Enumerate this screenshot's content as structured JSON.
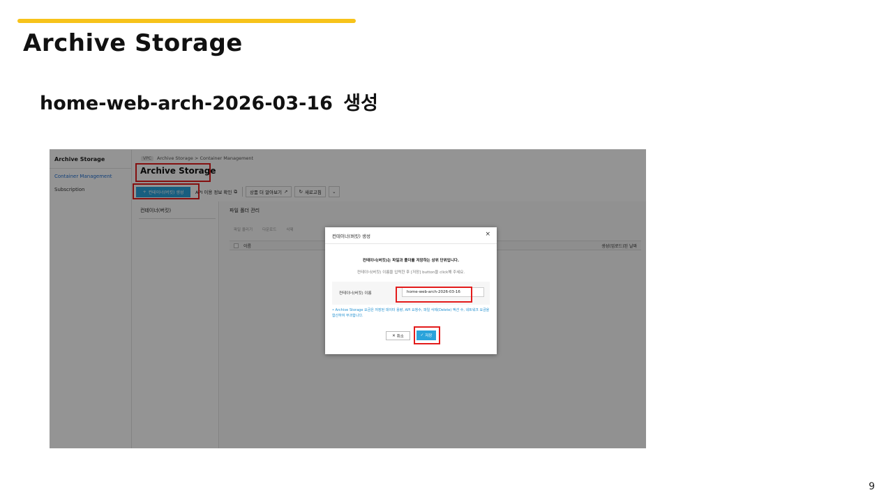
{
  "slide": {
    "title": "Archive Storage",
    "subtitle": "home-web-arch-2026-03-16  생성",
    "page_number": "9",
    "accent_color": "#f7c31a",
    "highlight_color": "#e31b1b"
  },
  "screenshot": {
    "sidebar": {
      "title": "Archive Storage",
      "items": [
        {
          "label": "Container Management",
          "active": true
        },
        {
          "label": "Subscription",
          "active": false
        }
      ]
    },
    "breadcrumb": {
      "vpc": "VPC",
      "items": [
        "Archive Storage",
        "Container Management"
      ],
      "separator": ">"
    },
    "main_title": "Archive Storage",
    "toolbar": {
      "create_label": "컨테이너(버킷) 생성",
      "api_label": "API 이용 정보 확인",
      "more_label": "상품 더 알아보기",
      "refresh_label": "새로고침"
    },
    "left_panel_title": "컨테이너(버킷)",
    "right_panel": {
      "title": "파일 폴더 관리",
      "tools": [
        "파일 올리기",
        "다운로드",
        "삭제"
      ],
      "col_name": "이름",
      "col_date": "생성(업로드)된 날짜"
    },
    "modal": {
      "title": "컨테이너(버킷) 생성",
      "description": "컨테이너(버킷)는 파일과 폴더를 저장하는 상위 단위입니다.",
      "hint": "컨테이너(버킷) 이름을 입력한 후 [저장] button을 click해 주세요.",
      "name_label": "컨테이너(버킷) 이름",
      "name_value": "home-web-arch-2026-03-16",
      "note": "• Archive Storage 요금은 저장된 데이터 용량, API 요청수, 파일 삭제(Delete) 액션 수, 네트워크 요금을 합산하여 부과합니다.",
      "cancel_label": "취소",
      "save_label": "저장",
      "primary_color": "#2aa3db"
    }
  }
}
